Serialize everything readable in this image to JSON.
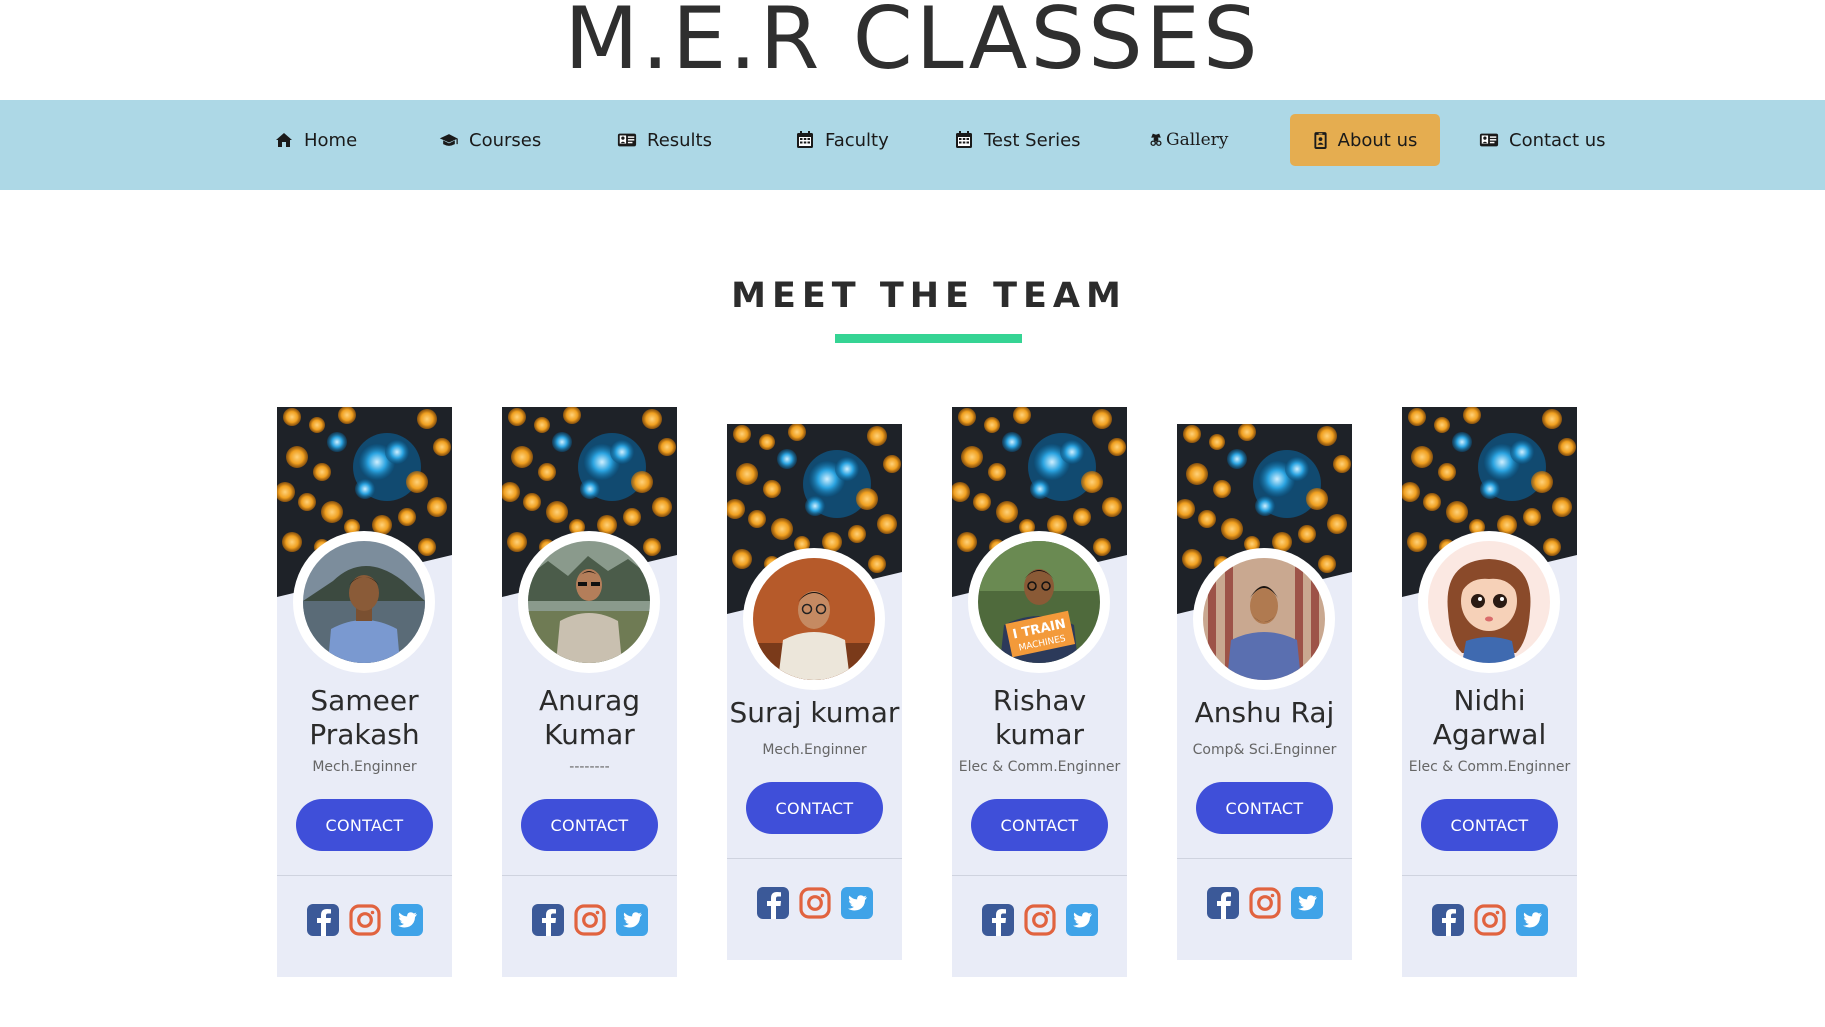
{
  "site": {
    "title": "M.E.R CLASSES"
  },
  "nav": [
    {
      "label": "Home",
      "icon": "home-icon"
    },
    {
      "label": "Courses",
      "icon": "graduation-cap-icon"
    },
    {
      "label": "Results",
      "icon": "id-card-icon"
    },
    {
      "label": "Faculty",
      "icon": "calendar-icon"
    },
    {
      "label": "Test Series",
      "icon": "calendar-icon"
    },
    {
      "label": "Gallery",
      "icon": "user-secret-icon"
    },
    {
      "label": "About us",
      "icon": "id-badge-icon",
      "active": true
    },
    {
      "label": "Contact us",
      "icon": "id-card-icon"
    }
  ],
  "colors": {
    "navbar": "#add8e6",
    "active_nav": "#e5ad50",
    "underline": "#35d494",
    "button": "#3f4fd9",
    "card": "#e9ecf7"
  },
  "section": {
    "title": "MEET THE TEAM"
  },
  "team": [
    {
      "name_line1": "Sameer",
      "name_line2": "Prakash",
      "role": "Mech.Enginner",
      "button": "CONTACT",
      "avatar": "man-blue-checked-shirt"
    },
    {
      "name_line1": "Anurag",
      "name_line2": "Kumar",
      "role": "--------",
      "button": "CONTACT",
      "avatar": "man-grey-sweater-sunglasses"
    },
    {
      "name_line1": "Suraj kumar",
      "name_line2": "",
      "role": "Mech.Enginner",
      "button": "CONTACT",
      "avatar": "man-white-shirt-glasses"
    },
    {
      "name_line1": "Rishav",
      "name_line2": "kumar",
      "role": "Elec & Comm.Enginner",
      "button": "CONTACT",
      "avatar": "man-holding-sign"
    },
    {
      "name_line1": "Anshu Raj",
      "name_line2": "",
      "role": "Comp& Sci.Enginner",
      "button": "CONTACT",
      "avatar": "man-checked-shirt-curtain"
    },
    {
      "name_line1": "Nidhi",
      "name_line2": "Agarwal",
      "role": "Elec & Comm.Enginner",
      "button": "CONTACT",
      "avatar": "cartoon-girl"
    }
  ],
  "social_icons": [
    "facebook-icon",
    "instagram-icon",
    "twitter-icon"
  ]
}
